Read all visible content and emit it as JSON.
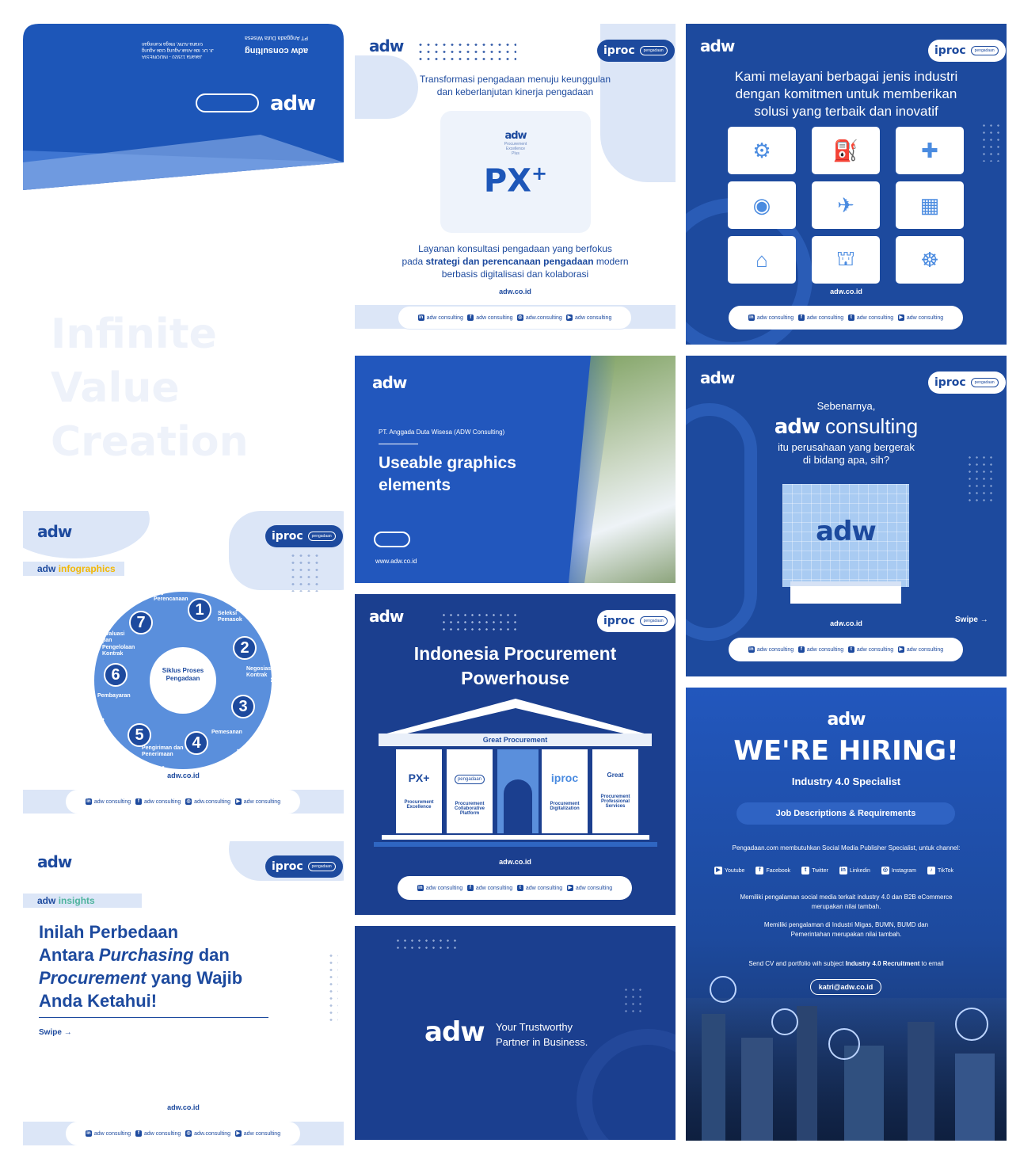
{
  "envelope": {
    "logo": "adw",
    "company_mirrored": "adw consulting",
    "company_line": "PT Anggada Duta Wisesa",
    "address1": "Jakarta 12920 - INDONESIA",
    "address2": "Jl. Dr. Ide Anak Agung Gde Agung",
    "address3": "Graha ADW, Mega Kuningan"
  },
  "tagline": {
    "line1": "Infinite",
    "line2": "Value",
    "line3": "Creation"
  },
  "px_post": {
    "logo": "adw",
    "iproc": "iproc",
    "pengadaan": "pengadaan",
    "headline1": "Transformasi pengadaan menuju keunggulan",
    "headline2": "dan keberlanjutan kinerja pengadaan",
    "badge_logo": "adw",
    "badge_sub1": "Procurement",
    "badge_sub2": "Excellence",
    "badge_sub3": "Plus",
    "badge_main": "PX",
    "badge_plus": "+",
    "body1": "Layanan konsultasi pengadaan yang berfokus",
    "body2_pre": "pada ",
    "body2_bold": "strategi dan perencanaan pengadaan",
    "body2_post": " modern",
    "body3": "berbasis digitalisasi dan kolaborasi",
    "url": "adw.co.id",
    "social": [
      "adw consulting",
      "adw consulting",
      "adw.consulting",
      "adw consulting"
    ]
  },
  "industry_post": {
    "logo": "adw",
    "iproc": "iproc",
    "pengadaan": "pengadaan",
    "headline1": "Kami melayani berbagai jenis industri",
    "headline2": "dengan komitmen untuk memberikan",
    "headline3": "solusi yang terbaik dan inovatif",
    "url": "adw.co.id",
    "icons": [
      "wind-turbine-icon",
      "oil-pump-icon",
      "medicine-icon",
      "satellite-icon",
      "transport-icon",
      "hospital-icon",
      "plant-icon",
      "government-icon",
      "city-icon"
    ],
    "social": [
      "adw consulting",
      "adw consulting",
      "adw consulting",
      "adw consulting"
    ]
  },
  "graphics_post": {
    "logo": "adw",
    "company": "PT. Anggada Duta Wisesa (ADW Consulting)",
    "title1": "Useable graphics",
    "title2": "elements",
    "url": "www.adw.co.id"
  },
  "consulting_post": {
    "logo": "adw",
    "iproc": "iproc",
    "pengadaan": "pengadaan",
    "intro": "Sebenarnya,",
    "brand_bold": "adw",
    "brand_light": "consulting",
    "q1": "itu perusahaan yang bergerak",
    "q2": "di bidang apa, sih?",
    "building_logo": "adw",
    "url": "adw.co.id",
    "swipe": "Swipe",
    "social": [
      "adw consulting",
      "adw consulting",
      "adw consulting",
      "adw consulting"
    ]
  },
  "infographics_post": {
    "logo": "adw",
    "iproc": "iproc",
    "pengadaan": "pengadaan",
    "tag_bold": "adw",
    "tag_color": "infographics",
    "center1": "Siklus Proses",
    "center2": "Pengadaan",
    "steps": [
      {
        "n": "1",
        "label": "Perencanaan"
      },
      {
        "n": "2",
        "label": "Negosiasi Kontrak"
      },
      {
        "n": "3",
        "label": "Pemesanan"
      },
      {
        "n": "4",
        "label": "Pengiriman dan Penerimaan"
      },
      {
        "n": "5",
        "label": "Pengiriman dan Penerimaan"
      },
      {
        "n": "6",
        "label": "Pembayaran"
      },
      {
        "n": "7",
        "label": "Evaluasi dan Pengelolaan Kontrak"
      }
    ],
    "extra_label": "Seleksi Pemasok",
    "url": "adw.co.id",
    "social": [
      "adw consulting",
      "adw consulting",
      "adw.consulting",
      "adw consulting"
    ]
  },
  "powerhouse_post": {
    "logo": "adw",
    "iproc": "iproc",
    "pengadaan": "pengadaan",
    "title1": "Indonesia Procurement",
    "title2": "Powerhouse",
    "banner": "Great Procurement",
    "pillars": [
      {
        "logo": "PX+",
        "label": "Procurement Excellence"
      },
      {
        "logo": "pengadaan",
        "label": "Procurement Collaborative Platform"
      },
      {
        "logo": "iproc",
        "label": "Procurement Digitalization"
      },
      {
        "logo": "Great",
        "label": "Procurement Professional Services"
      }
    ],
    "url": "adw.co.id",
    "social": [
      "adw consulting",
      "adw consulting",
      "adw consulting",
      "adw consulting"
    ]
  },
  "hiring_post": {
    "logo": "adw",
    "title": "WE'RE HIRING!",
    "role": "Industry 4.0 Specialist",
    "section": "Job Descriptions & Requirements",
    "intro": "Pengadaan.com membutuhkan Social Media Publisher Specialist, untuk channel:",
    "channels": [
      "Youtube",
      "Facebook",
      "Twitter",
      "Linkedin",
      "Instagram",
      "TikTok"
    ],
    "req1a": "Memiliki pengalaman social media terkait industry 4.0 dan B2B eCommerce",
    "req1b": "merupakan nilai tambah.",
    "req2a": "Memiliki pengalaman di Industri Migas, BUMN, BUMD dan",
    "req2b": "Pemerintahan merupakan nilai tambah.",
    "send_pre": "Send CV and portfolio wih subject ",
    "send_bold": "Industry 4.0 Recruitment",
    "send_post": " to email",
    "email": "katri@adw.co.id"
  },
  "insights_post": {
    "logo": "adw",
    "iproc": "iproc",
    "pengadaan": "pengadaan",
    "tag_bold": "adw",
    "tag_color": "insights",
    "h1": "Inilah Perbedaan",
    "h2_pre": "Antara ",
    "h2_it": "Purchasing",
    "h2_post": " dan",
    "h3_it": "Procurement",
    "h3_post": " yang Wajib",
    "h4": "Anda Ketahui!",
    "swipe": "Swipe",
    "url": "adw.co.id",
    "social": [
      "adw consulting",
      "adw consulting",
      "adw.consulting",
      "adw consulting"
    ]
  },
  "partner_post": {
    "logo": "adw",
    "line1": "Your Trustworthy",
    "line2": "Partner in Business."
  },
  "colors": {
    "primary": "#1d4a9e",
    "light": "#dce6f7",
    "accent": "#f2b705"
  }
}
